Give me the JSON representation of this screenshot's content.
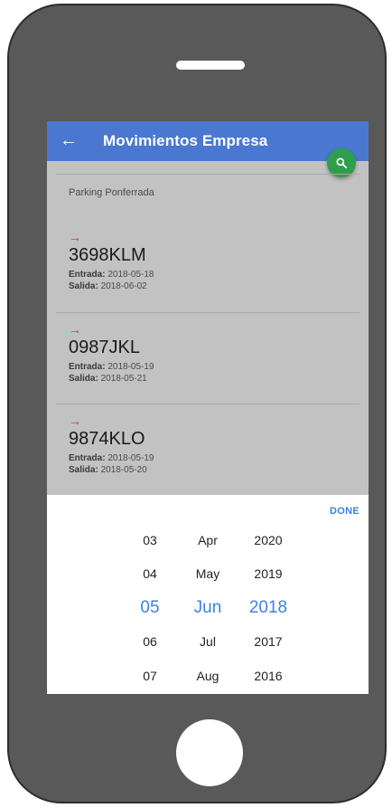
{
  "appbar": {
    "back_icon": "arrow-left-icon",
    "title": "Movimientos Empresa",
    "fab_icon": "search-icon",
    "fab_color": "#2e9e4c",
    "color": "#4a78d0"
  },
  "location": "Parking Ponferrada",
  "entries": [
    {
      "plate": "3698KLM",
      "entrada_label": "Entrada:",
      "entrada": "2018-05-18",
      "salida_label": "Salida:",
      "salida": "2018-06-02"
    },
    {
      "plate": "0987JKL",
      "entrada_label": "Entrada:",
      "entrada": "2018-05-19",
      "salida_label": "Salida:",
      "salida": "2018-05-21"
    },
    {
      "plate": "9874KLO",
      "entrada_label": "Entrada:",
      "entrada": "2018-05-19",
      "salida_label": "Salida:",
      "salida": "2018-05-20"
    }
  ],
  "picker": {
    "done_label": "DONE",
    "accent": "#3b82e0",
    "days": [
      "03",
      "04",
      "05",
      "06",
      "07"
    ],
    "months": [
      "Apr",
      "May",
      "Jun",
      "Jul",
      "Aug"
    ],
    "years": [
      "2020",
      "2019",
      "2018",
      "2017",
      "2016"
    ],
    "selected_day": "05",
    "selected_month": "Jun",
    "selected_year": "2018"
  }
}
